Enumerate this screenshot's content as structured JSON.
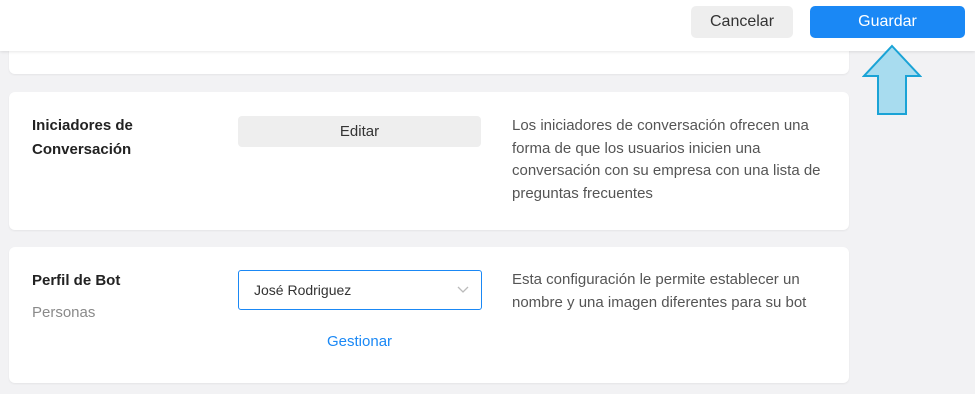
{
  "toolbar": {
    "cancel_label": "Cancelar",
    "save_label": "Guardar"
  },
  "iniciadores": {
    "title_line1": "Iniciadores de",
    "title_line2": "Conversación",
    "edit_label": "Editar",
    "description": "Los iniciadores de conversación ofrecen una forma de que los usuarios inicien una conversación con su empresa con una lista de preguntas frecuentes"
  },
  "perfil": {
    "title": "Perfil de Bot",
    "subtitle": "Personas",
    "selected_value": "José Rodriguez",
    "manage_label": "Gestionar",
    "description": "Esta configuración le permite establecer un nombre y una imagen diferentes para su bot"
  },
  "icons": {
    "select_chevron": "chevron-down-icon",
    "pointer": "arrow-up-icon"
  },
  "colors": {
    "primary": "#1a88f5",
    "arrow_fill": "#a8dcef",
    "arrow_stroke": "#1aa3d6"
  }
}
